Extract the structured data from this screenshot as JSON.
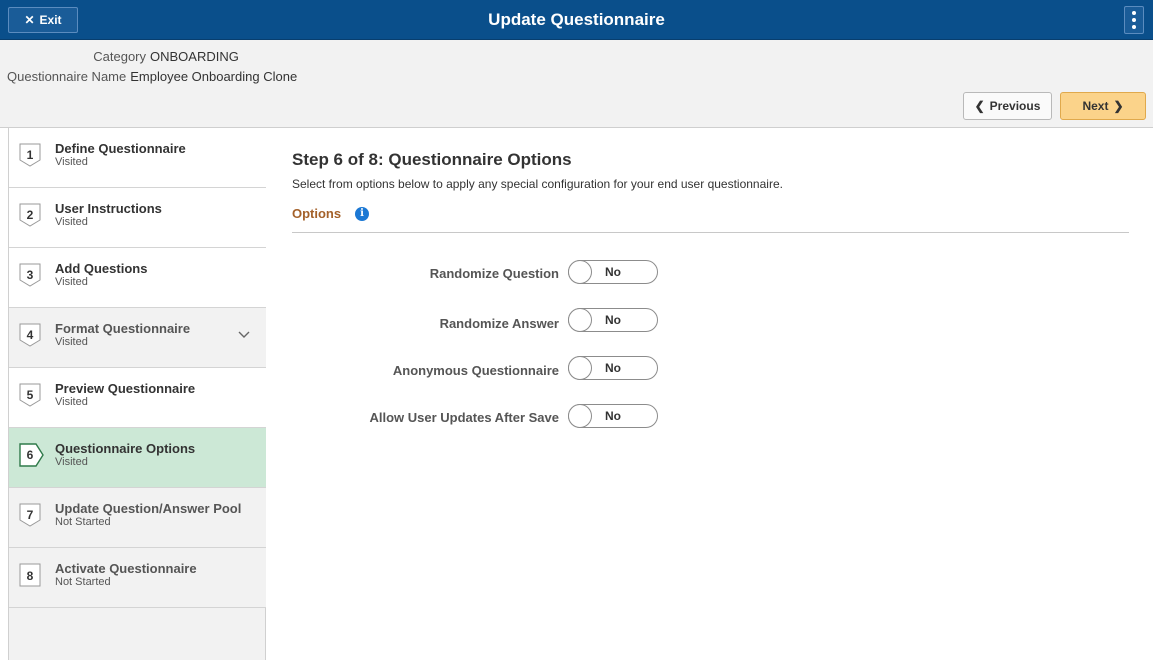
{
  "header": {
    "exit_label": "Exit",
    "title": "Update Questionnaire"
  },
  "info": {
    "category_label": "Category",
    "category_value": "ONBOARDING",
    "name_label": "Questionnaire Name",
    "name_value": "Employee Onboarding Clone"
  },
  "nav": {
    "previous_label": "Previous",
    "next_label": "Next"
  },
  "steps": [
    {
      "number": "1",
      "title": "Define Questionnaire",
      "status": "Visited"
    },
    {
      "number": "2",
      "title": "User Instructions",
      "status": "Visited"
    },
    {
      "number": "3",
      "title": "Add Questions",
      "status": "Visited"
    },
    {
      "number": "4",
      "title": "Format Questionnaire",
      "status": "Visited"
    },
    {
      "number": "5",
      "title": "Preview Questionnaire",
      "status": "Visited"
    },
    {
      "number": "6",
      "title": "Questionnaire Options",
      "status": "Visited"
    },
    {
      "number": "7",
      "title": "Update Question/Answer Pool",
      "status": "Not Started"
    },
    {
      "number": "8",
      "title": "Activate Questionnaire",
      "status": "Not Started"
    }
  ],
  "main": {
    "heading": "Step 6 of 8: Questionnaire Options",
    "description": "Select from options below to apply any special configuration for your end user questionnaire.",
    "options_header": "Options",
    "options": [
      {
        "label": "Randomize Question",
        "value": "No"
      },
      {
        "label": "Randomize Answer",
        "value": "No"
      },
      {
        "label": "Anonymous Questionnaire",
        "value": "No"
      },
      {
        "label": "Allow User Updates After Save",
        "value": "No"
      }
    ]
  },
  "colors": {
    "header_bg": "#0a4f8b",
    "next_button": "#fbd38a",
    "active_step": "#cce8d6",
    "options_header": "#a4612a",
    "info_icon": "#1b78d4"
  },
  "icons": {
    "exit": "close-icon",
    "menu": "kebab-menu-icon",
    "previous": "chevron-left-icon",
    "next": "chevron-right-icon",
    "expand": "chevron-down-icon",
    "info": "info-icon"
  }
}
